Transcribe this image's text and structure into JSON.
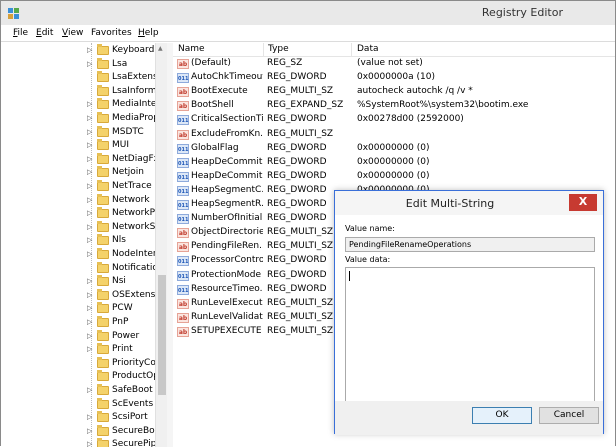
{
  "window": {
    "title": "Registry Editor",
    "icon": "regedit-icon"
  },
  "menu": [
    {
      "mnemonic": "F",
      "rest": "ile"
    },
    {
      "mnemonic": "E",
      "rest": "dit"
    },
    {
      "mnemonic": "V",
      "rest": "iew"
    },
    {
      "mnemonic": "",
      "rest": "Favorites"
    },
    {
      "mnemonic": "H",
      "rest": "elp"
    }
  ],
  "tree": {
    "items": [
      "Keyboard L",
      "Lsa",
      "LsaExtensio",
      "LsaInforma",
      "MediaInter",
      "MediaProp",
      "MSDTC",
      "MUI",
      "NetDiagFx",
      "Netjoin",
      "NetTrace",
      "Network",
      "NetworkPr",
      "NetworkSe",
      "Nls",
      "NodeInterf",
      "Notificatio",
      "Nsi",
      "OSExtensio",
      "PCW",
      "PnP",
      "Power",
      "Print",
      "PriorityCor",
      "ProductOp",
      "SafeBoot",
      "ScEvents",
      "ScsiPort",
      "SecureBoot",
      "SecurePipe"
    ],
    "expandable": [
      true,
      true,
      false,
      false,
      true,
      true,
      true,
      true,
      true,
      true,
      true,
      true,
      true,
      true,
      true,
      true,
      false,
      true,
      true,
      true,
      true,
      true,
      true,
      false,
      false,
      true,
      false,
      true,
      true,
      true
    ]
  },
  "columns": {
    "name": "Name",
    "type": "Type",
    "data": "Data"
  },
  "values": [
    {
      "icon": "ab",
      "name": "(Default)",
      "type": "REG_SZ",
      "data": "(value not set)"
    },
    {
      "icon": "bin",
      "name": "AutoChkTimeout",
      "type": "REG_DWORD",
      "data": "0x0000000a (10)"
    },
    {
      "icon": "ab",
      "name": "BootExecute",
      "type": "REG_MULTI_SZ",
      "data": "autocheck autochk /q /v *"
    },
    {
      "icon": "ab",
      "name": "BootShell",
      "type": "REG_EXPAND_SZ",
      "data": "%SystemRoot%\\system32\\bootim.exe"
    },
    {
      "icon": "bin",
      "name": "CriticalSectionTi...",
      "type": "REG_DWORD",
      "data": "0x00278d00 (2592000)"
    },
    {
      "icon": "ab",
      "name": "ExcludeFromKn...",
      "type": "REG_MULTI_SZ",
      "data": ""
    },
    {
      "icon": "bin",
      "name": "GlobalFlag",
      "type": "REG_DWORD",
      "data": "0x00000000 (0)"
    },
    {
      "icon": "bin",
      "name": "HeapDeCommit...",
      "type": "REG_DWORD",
      "data": "0x00000000 (0)"
    },
    {
      "icon": "bin",
      "name": "HeapDeCommit...",
      "type": "REG_DWORD",
      "data": "0x00000000 (0)"
    },
    {
      "icon": "bin",
      "name": "HeapSegmentC...",
      "type": "REG_DWORD",
      "data": "0x00000000 (0)"
    },
    {
      "icon": "bin",
      "name": "HeapSegmentR...",
      "type": "REG_DWORD",
      "data": ""
    },
    {
      "icon": "bin",
      "name": "NumberOfInitial...",
      "type": "REG_DWORD",
      "data": ""
    },
    {
      "icon": "ab",
      "name": "ObjectDirectories",
      "type": "REG_MULTI_SZ",
      "data": ""
    },
    {
      "icon": "ab",
      "name": "PendingFileRen...",
      "type": "REG_MULTI_SZ",
      "data": ""
    },
    {
      "icon": "bin",
      "name": "ProcessorControl",
      "type": "REG_DWORD",
      "data": ""
    },
    {
      "icon": "bin",
      "name": "ProtectionMode",
      "type": "REG_DWORD",
      "data": ""
    },
    {
      "icon": "bin",
      "name": "ResourceTimeo...",
      "type": "REG_DWORD",
      "data": ""
    },
    {
      "icon": "ab",
      "name": "RunLevelExecute",
      "type": "REG_MULTI_SZ",
      "data": ""
    },
    {
      "icon": "ab",
      "name": "RunLevelValidate",
      "type": "REG_MULTI_SZ",
      "data": ""
    },
    {
      "icon": "ab",
      "name": "SETUPEXECUTE",
      "type": "REG_MULTI_SZ",
      "data": ""
    }
  ],
  "dialog": {
    "title": "Edit Multi-String",
    "close": "X",
    "value_name_label_mn": "",
    "value_name_label": "Value name:",
    "value_name": "PendingFileRenameOperations",
    "value_data_label": "Value data:",
    "value_data": "",
    "ok": "OK",
    "cancel": "Cancel"
  },
  "colors": {
    "accent": "#3a6fd8",
    "close": "#c73a31",
    "folder": "#f4d26a"
  }
}
